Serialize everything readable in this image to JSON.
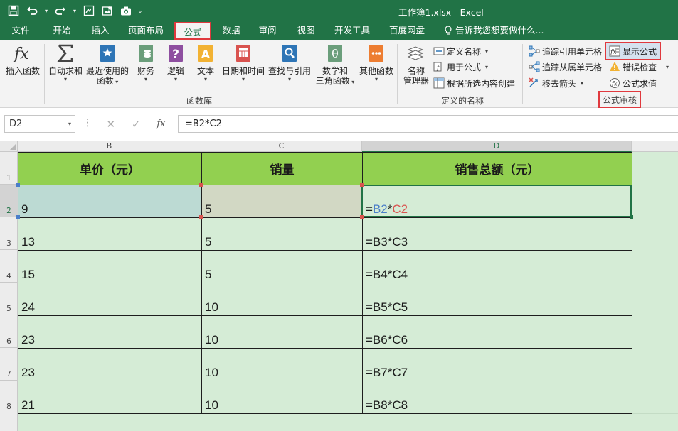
{
  "window": {
    "title": "工作簿1.xlsx - Excel"
  },
  "qat": {
    "icons": [
      "save-icon",
      "undo-icon",
      "redo-icon",
      "print-preview-icon",
      "image-icon",
      "camera-icon"
    ],
    "customize_glyph": "⌄"
  },
  "tabs": [
    {
      "label": "文件"
    },
    {
      "label": "开始"
    },
    {
      "label": "插入"
    },
    {
      "label": "页面布局"
    },
    {
      "label": "公式"
    },
    {
      "label": "数据"
    },
    {
      "label": "审阅"
    },
    {
      "label": "视图"
    },
    {
      "label": "开发工具"
    },
    {
      "label": "百度网盘"
    }
  ],
  "active_tab": "公式",
  "tell_me": {
    "text": "告诉我您想要做什么..."
  },
  "ribbon": {
    "insert_function": {
      "label": "插入函数"
    },
    "library": {
      "autosum": {
        "label": "自动求和"
      },
      "recent_line1": "最近使用的",
      "recent_line2": "函数",
      "financial": {
        "label": "财务"
      },
      "logical": {
        "label": "逻辑"
      },
      "text": {
        "label": "文本"
      },
      "datetime": {
        "label": "日期和时间"
      },
      "lookup": {
        "label": "查找与引用"
      },
      "math_line1": "数学和",
      "math_line2": "三角函数",
      "other": {
        "label": "其他函数"
      },
      "group_label": "函数库"
    },
    "defined_names": {
      "manager_line1": "名称",
      "manager_line2": "管理器",
      "define_name": "定义名称",
      "use_in_formula": "用于公式",
      "create_from_selection": "根据所选内容创建",
      "group_label": "定义的名称"
    },
    "auditing": {
      "trace_precedents": "追踪引用单元格",
      "trace_dependents": "追踪从属单元格",
      "remove_arrows": "移去箭头",
      "show_formulas": "显示公式",
      "error_checking": "错误检查",
      "evaluate_formula": "公式求值",
      "group_label": "公式审核"
    }
  },
  "formula_bar": {
    "name_box": "D2",
    "cancel": "✕",
    "enter": "✓",
    "fx": "fx",
    "formula": "=B2*C2"
  },
  "columns": [
    "B",
    "C",
    "D"
  ],
  "rows": [
    "1",
    "2",
    "3",
    "4",
    "5",
    "6",
    "7",
    "8"
  ],
  "table": {
    "headers": {
      "b": "单价（元）",
      "c": "销量",
      "d": "销售总额（元）"
    },
    "data": [
      {
        "b": "9",
        "c": "5",
        "d": {
          "pre": "=",
          "ref1": "B2",
          "op": "*",
          "ref2": "C2"
        }
      },
      {
        "b": "13",
        "c": "5",
        "d": "=B3*C3"
      },
      {
        "b": "15",
        "c": "5",
        "d": "=B4*C4"
      },
      {
        "b": "24",
        "c": "10",
        "d": "=B5*C5"
      },
      {
        "b": "23",
        "c": "10",
        "d": "=B6*C6"
      },
      {
        "b": "23",
        "c": "10",
        "d": "=B7*C7"
      },
      {
        "b": "21",
        "c": "10",
        "d": "=B8*C8"
      }
    ]
  },
  "colors": {
    "excel_green": "#217346",
    "header_fill": "#92d050",
    "sheet_fill": "#d5ecd6",
    "highlight_red": "#e0393e",
    "ref_blue": "#4a7ec9",
    "ref_red": "#d9534f"
  }
}
